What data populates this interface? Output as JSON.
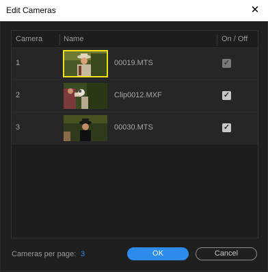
{
  "window": {
    "title": "Edit Cameras",
    "close_glyph": "✕"
  },
  "table": {
    "headers": {
      "camera": "Camera",
      "name": "Name",
      "onoff": "On / Off"
    },
    "rows": [
      {
        "camera": "1",
        "name": "00019.MTS",
        "checked": true,
        "enabled": false,
        "selected": true
      },
      {
        "camera": "2",
        "name": "Clip0012.MXF",
        "checked": true,
        "enabled": true,
        "selected": false
      },
      {
        "camera": "3",
        "name": "00030.MTS",
        "checked": true,
        "enabled": true,
        "selected": false
      }
    ]
  },
  "footer": {
    "cameras_per_page_label": "Cameras per page:",
    "cameras_per_page_value": "3",
    "ok_label": "OK",
    "cancel_label": "Cancel"
  },
  "colors": {
    "accent": "#2d8ceb",
    "selection": "#f3e21a",
    "background": "#1f1f1f"
  }
}
